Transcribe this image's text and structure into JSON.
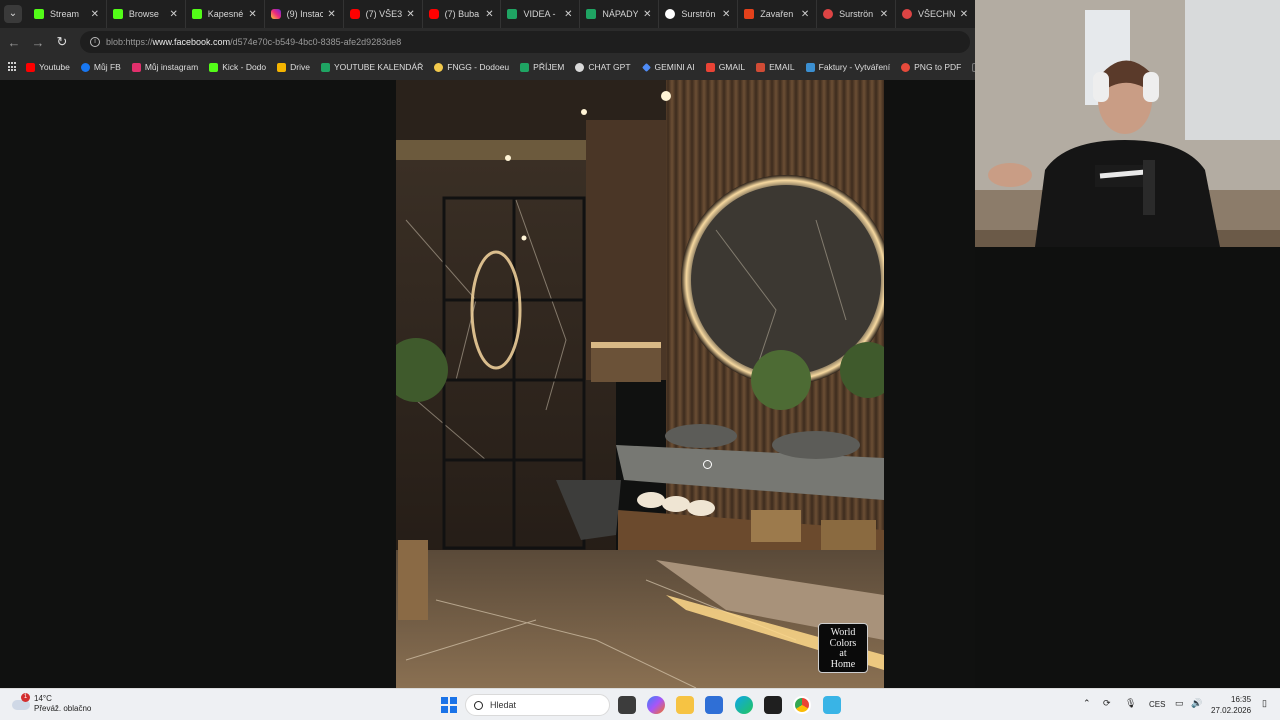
{
  "browser": {
    "tabs": [
      {
        "title": "Stream",
        "icon": "kick-icon"
      },
      {
        "title": "Browse",
        "icon": "kick-icon"
      },
      {
        "title": "Kapesné",
        "icon": "kick-icon"
      },
      {
        "title": "(9) Instac",
        "icon": "instagram-icon"
      },
      {
        "title": "(7) VŠE3",
        "icon": "youtube-icon"
      },
      {
        "title": "(7) Buba",
        "icon": "youtube-icon"
      },
      {
        "title": "VIDEA - ",
        "icon": "sheets-icon"
      },
      {
        "title": "NÁPADY",
        "icon": "sheets-icon"
      },
      {
        "title": "Surströn",
        "icon": "google-icon"
      },
      {
        "title": "Zavařen",
        "icon": "red-app-icon"
      },
      {
        "title": "Surströn",
        "icon": "surstromming-icon"
      },
      {
        "title": "VŠECHN",
        "icon": "surstromming-icon"
      }
    ],
    "address": {
      "prefix": "blob:https://",
      "domain": "www.facebook.com",
      "rest": "/d574e70c-b549-4bc0-8385-afe2d9283de8"
    },
    "bookmarks": [
      {
        "label": "Youtube",
        "color": "#ff0000"
      },
      {
        "label": "Můj FB",
        "color": "#1877f2"
      },
      {
        "label": "Můj instagram",
        "color": "#e1306c"
      },
      {
        "label": "Kick - Dodo",
        "color": "#53fc18"
      },
      {
        "label": "Drive",
        "color": "#f4b400"
      },
      {
        "label": "YOUTUBE KALENDÁŘ",
        "color": "#1fa463"
      },
      {
        "label": "FNGG - Dodoeu",
        "color": "#f2c94c"
      },
      {
        "label": "PŘÍJEM",
        "color": "#1fa463"
      },
      {
        "label": "CHAT GPT",
        "color": "#d9d9d9"
      },
      {
        "label": "GEMINI AI",
        "color": "#4f8cf7"
      },
      {
        "label": "GMAIL",
        "color": "#ea4335"
      },
      {
        "label": "EMAIL",
        "color": "#d14b35"
      },
      {
        "label": "Faktury - Vytváření",
        "color": "#3b8fd1"
      },
      {
        "label": "PNG to PDF",
        "color": "#e64a3b"
      }
    ]
  },
  "image": {
    "watermark_line1": "World",
    "watermark_line2": "Colors",
    "watermark_line3": "at",
    "watermark_line4": "Home"
  },
  "taskbar": {
    "weather_temp": "14°C",
    "weather_desc": "Převáž. oblačno",
    "weather_badge": "1",
    "search_placeholder": "Hledat",
    "language": "CES",
    "time": "16:35",
    "date": "27.02.2026"
  }
}
